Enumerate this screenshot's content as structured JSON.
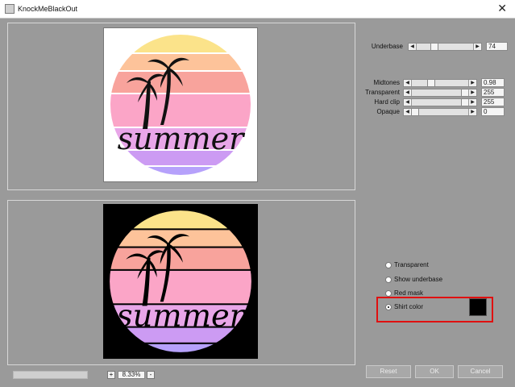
{
  "window": {
    "title": "KnockMeBlackOut",
    "close_glyph": "✕",
    "app_icon": "app-icon"
  },
  "controls": {
    "underbase": {
      "label": "Underbase",
      "value": "74",
      "level": 0.29
    },
    "midtones": {
      "label": "Midtones",
      "value": "0.98",
      "level": 0.33
    },
    "transparent": {
      "label": "Transparent",
      "value": "255",
      "level": 1.0
    },
    "hard_clip": {
      "label": "Hard clip",
      "value": "255",
      "level": 1.0
    },
    "opaque": {
      "label": "Opaque",
      "value": "0",
      "level": 0.0
    }
  },
  "display_modes": {
    "options": [
      "Transparent",
      "Show underbase",
      "Red mask",
      "Shirt color"
    ],
    "selected": "Shirt color"
  },
  "shirt_color": "#000000",
  "highlight_color": "#e01010",
  "buttons": {
    "reset": "Reset",
    "ok": "OK",
    "cancel": "Cancel"
  },
  "zoom": {
    "plus": "+",
    "minus": "-",
    "value": "8.33%"
  },
  "artwork": {
    "text": "summer",
    "stripe_colors": [
      "#fbe38a",
      "#fdc39a",
      "#f8a39c",
      "#fba5c7",
      "#e8a6e8",
      "#cc9bf3",
      "#b6a1fb"
    ]
  }
}
